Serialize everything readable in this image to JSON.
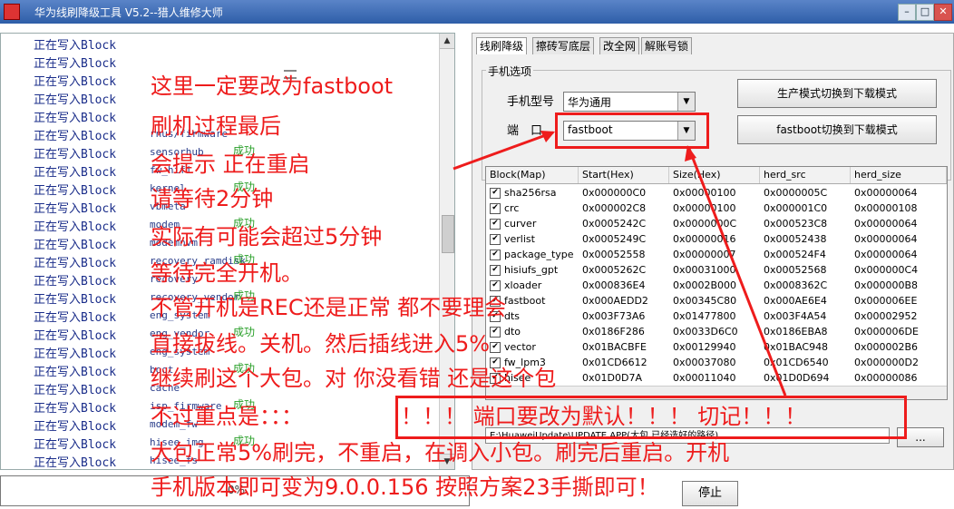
{
  "window": {
    "title": "华为线刷降级工具 V5.2--猎人维修大师",
    "min_label": "–",
    "max_label": "□",
    "close_label": "✕"
  },
  "log": {
    "block_lines": [
      "正在写入Block",
      "正在写入Block",
      "正在写入Block",
      "正在写入Block",
      "正在写入Block",
      "正在写入Block",
      "正在写入Block",
      "正在写入Block",
      "正在写入Block",
      "正在写入Block",
      "正在写入Block",
      "正在写入Block",
      "正在写入Block",
      "正在写入Block",
      "正在写入Block",
      "正在写入Block",
      "正在写入Block",
      "正在写入Block",
      "正在写入Block",
      "正在写入Block",
      "正在写入Block",
      "正在写入Block",
      "正在写入Block",
      "正在写入Block"
    ],
    "partition_lines": [
      "rnus/firmware",
      "sensorhub",
      "fw_hifi",
      "kernel",
      "vbmeta",
      "modem",
      "modemnvm",
      "recovery_ramdisk",
      "recovery",
      "recovery_vendor",
      "eng_system",
      "eng_vendor",
      "eng_system",
      "boot",
      "cache",
      "isp_firmware",
      "modem_fw",
      "hisee_img",
      "hisee_fs",
      "vendor"
    ],
    "success_label": "成功"
  },
  "progress": {
    "text": "0%"
  },
  "tabs": [
    "线刷降级",
    "擦砖写底层",
    "改全网",
    "解账号锁"
  ],
  "phone_group": {
    "title": "手机选项",
    "model_label": "手机型号",
    "model_value": "华为通用",
    "port_label": "端　口",
    "port_value": "fastboot"
  },
  "buttons": {
    "prod_to_download": "生产模式切换到下载模式",
    "fastboot_to_download": "fastboot切换到下载模式",
    "browse": "...",
    "stop": "停止"
  },
  "grid": {
    "headers": [
      "Block(Map)",
      "Start(Hex)",
      "Size(Hex)",
      "herd_src",
      "herd_size"
    ],
    "rows": [
      [
        "sha256rsa",
        "0x000000C0",
        "0x00000100",
        "0x0000005C",
        "0x00000064"
      ],
      [
        "crc",
        "0x000002C8",
        "0x00000100",
        "0x000001C0",
        "0x00000108"
      ],
      [
        "curver",
        "0x0005242C",
        "0x0000000C",
        "0x000523C8",
        "0x00000064"
      ],
      [
        "verlist",
        "0x0005249C",
        "0x00000016",
        "0x00052438",
        "0x00000064"
      ],
      [
        "package_type",
        "0x00052558",
        "0x00000007",
        "0x000524F4",
        "0x00000064"
      ],
      [
        "hisiufs_gpt",
        "0x0005262C",
        "0x00031000",
        "0x00052568",
        "0x000000C4"
      ],
      [
        "xloader",
        "0x000836E4",
        "0x0002B000",
        "0x0008362C",
        "0x000000B8"
      ],
      [
        "fastboot",
        "0x000AEDD2",
        "0x00345C80",
        "0x000AE6E4",
        "0x000006EE"
      ],
      [
        "dts",
        "0x003F73A6",
        "0x01477800",
        "0x003F4A54",
        "0x00002952"
      ],
      [
        "dto",
        "0x0186F286",
        "0x0033D6C0",
        "0x0186EBA8",
        "0x000006DE"
      ],
      [
        "vector",
        "0x01BACBFE",
        "0x00129940",
        "0x01BAC948",
        "0x000002B6"
      ],
      [
        "fw_lpm3",
        "0x01CD6612",
        "0x00037080",
        "0x01CD6540",
        "0x000000D2"
      ],
      [
        "hisee",
        "0x01D0D7A",
        "0x00011040",
        "0x01D0D694",
        "0x00000086"
      ],
      [
        "teeos",
        "0x01D1FDDA",
        "0x0030D100",
        "0x01D1F75C",
        "0x0000067E"
      ]
    ]
  },
  "file_path": "E:\\HuaweiUpdate\\UPDATE.APP(大包 已经选好的路径)",
  "annotations": {
    "line1": "这里一定要改为fastboot",
    "line2": "刷机过程最后",
    "line3": "会提示 正在重启",
    "line4": "请等待2分钟",
    "line5": "实际有可能会超过5分钟",
    "line6": "等待完全开机。",
    "line7": "不管开机是REC还是正常 都不要理会",
    "line8": "直接拔线。关机。然后插线进入5%",
    "line9": "继续刷这个大包。对 你没看错  还是这个包",
    "line10": "不过重点是：：：",
    "line11": "！！！ 端口要改为默认！！！ 切记！！！",
    "line12": "大包正常5%刷完，不重启，在调入小包。刷完后重启。开机",
    "line13": "手机版本即可变为9.0.0.156  按照方案23手撕即可！"
  },
  "colors": {
    "annotation": "#ee1c1c",
    "log_text": "#1a2d8a",
    "success": "#2aa02a",
    "title_bar": "#2e5ea8"
  }
}
